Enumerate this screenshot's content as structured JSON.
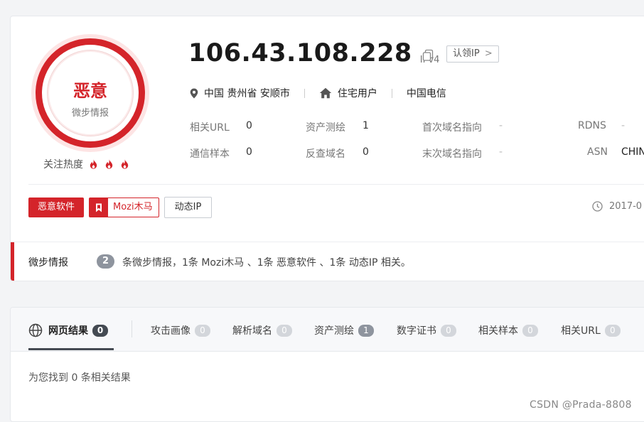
{
  "verdict": {
    "title": "恶意",
    "subtitle": "微步情报"
  },
  "heat": {
    "label": "关注热度",
    "flames": 3,
    "flame_color": "#d4242a"
  },
  "ip": {
    "address": "106.43.108.228",
    "version": "IPv4",
    "claim_label": "认领IP",
    "claim_chevron": ">"
  },
  "location": {
    "region": "中国 贵州省 安顺市",
    "usage": "住宅用户",
    "isp": "中国电信"
  },
  "stats": [
    {
      "key": "相关URL",
      "value": "0"
    },
    {
      "key": "资产测绘",
      "value": "1"
    },
    {
      "key": "首次域名指向",
      "value": "-"
    },
    {
      "key": "RDNS",
      "value": "-"
    },
    {
      "key": "通信样本",
      "value": "0"
    },
    {
      "key": "反查域名",
      "value": "0"
    },
    {
      "key": "末次域名指向",
      "value": "-"
    },
    {
      "key": "ASN",
      "value": "CHIN"
    }
  ],
  "tags": {
    "malware": "恶意软件",
    "mozi": "Mozi木马",
    "dynamic": "动态IP"
  },
  "date": "2017-0",
  "intel": {
    "label": "微步情报",
    "count": "2",
    "description": "条微步情报，1条 Mozi木马 、1条 恶意软件 、1条 动态IP 相关。"
  },
  "tabs": [
    {
      "label": "网页结果",
      "count": "0",
      "active": true
    },
    {
      "label": "攻击画像",
      "count": "0"
    },
    {
      "label": "解析域名",
      "count": "0"
    },
    {
      "label": "资产测绘",
      "count": "1"
    },
    {
      "label": "数字证书",
      "count": "0"
    },
    {
      "label": "相关样本",
      "count": "0"
    },
    {
      "label": "相关URL",
      "count": "0"
    }
  ],
  "result_text": "为您找到 0 条相关结果",
  "watermark": "CSDN @Prada-8808",
  "colors": {
    "accent_red": "#d4242a",
    "badge_gray": "#8e949e",
    "active_dark": "#444a52"
  }
}
